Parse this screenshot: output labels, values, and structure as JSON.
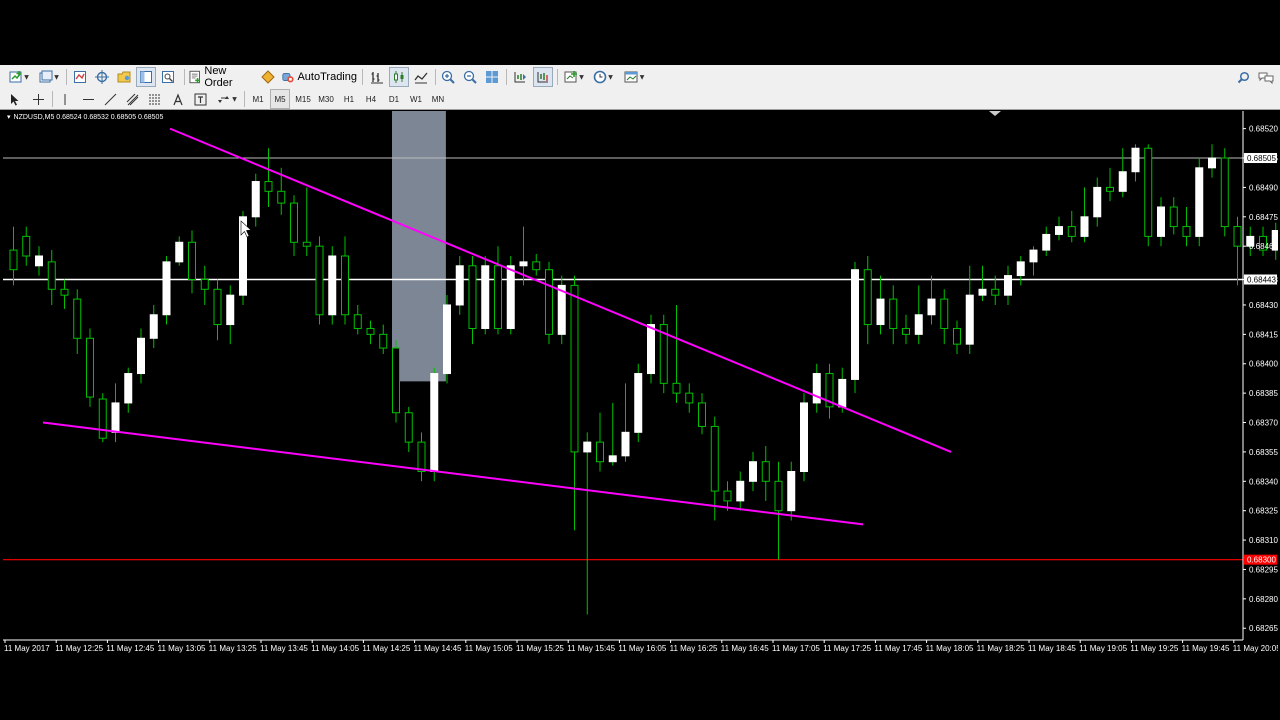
{
  "toolbar": {
    "new_order_label": "New Order",
    "autotrading_label": "AutoTrading",
    "timeframes": [
      "M1",
      "M5",
      "M15",
      "M30",
      "H1",
      "H4",
      "D1",
      "W1",
      "MN"
    ],
    "active_timeframe": "M5"
  },
  "chart": {
    "symbol_info": "NZDUSD,M5  0.68524 0.68532 0.68505 0.68505",
    "colors": {
      "background": "#000000",
      "bull_body": "#ffffff",
      "bear_body": "#000000",
      "wick": "#00c000",
      "trendline": "#ff00ff",
      "level_line": "#ffffff",
      "red_level": "#ff0000",
      "highlight_box": "#c8d8f0",
      "axis_text": "#ffffff"
    }
  },
  "chart_data": {
    "type": "candlestick",
    "price_ticks": [
      "0.68520",
      "0.68505",
      "0.68490",
      "0.68475",
      "0.68460",
      "0.68443",
      "0.68430",
      "0.68415",
      "0.68400",
      "0.68385",
      "0.68370",
      "0.68355",
      "0.68340",
      "0.68325",
      "0.68310",
      "0.68300",
      "0.68295",
      "0.68280",
      "0.68265"
    ],
    "price_label_current": "0.68505",
    "price_label_level": "0.68443",
    "price_label_red": "0.68300",
    "time_labels": [
      "11 May 2017",
      "11 May 12:25",
      "11 May 12:45",
      "11 May 13:05",
      "11 May 13:25",
      "11 May 13:45",
      "11 May 14:05",
      "11 May 14:25",
      "11 May 14:45",
      "11 May 15:05",
      "11 May 15:25",
      "11 May 15:45",
      "11 May 16:05",
      "11 May 16:25",
      "11 May 16:45",
      "11 May 17:05",
      "11 May 17:25",
      "11 May 17:45",
      "11 May 18:05",
      "11 May 18:25",
      "11 May 18:45",
      "11 May 19:05",
      "11 May 19:25",
      "11 May 19:45",
      "11 May 20:05"
    ],
    "horizontal_levels": {
      "white_upper": 0.68505,
      "white_level": 0.68443,
      "red": 0.683
    },
    "trendlines": [
      {
        "from": [
          0,
          0.6852
        ],
        "to": [
          37,
          0.68355
        ]
      },
      {
        "from": [
          -3,
          0.6837
        ],
        "to": [
          34,
          0.68318
        ]
      }
    ],
    "highlight_zone": {
      "from_index": 30,
      "to_index": 33.6,
      "low": 0.68391
    },
    "candles": [
      [
        0.68458,
        0.68448,
        0.6847,
        0.6844
      ],
      [
        0.68465,
        0.68455,
        0.6847,
        0.6845
      ],
      [
        0.6845,
        0.68455,
        0.6846,
        0.68445
      ],
      [
        0.68452,
        0.68438,
        0.68458,
        0.6843
      ],
      [
        0.68438,
        0.68435,
        0.68443,
        0.68428
      ],
      [
        0.68433,
        0.68413,
        0.68438,
        0.68405
      ],
      [
        0.68413,
        0.68383,
        0.68418,
        0.68378
      ],
      [
        0.68382,
        0.68362,
        0.68385,
        0.6836
      ],
      [
        0.68365,
        0.6838,
        0.6839,
        0.6836
      ],
      [
        0.6838,
        0.68395,
        0.68398,
        0.68375
      ],
      [
        0.68395,
        0.68413,
        0.68418,
        0.6839
      ],
      [
        0.68413,
        0.68425,
        0.6843,
        0.68408
      ],
      [
        0.68425,
        0.68452,
        0.68455,
        0.6842
      ],
      [
        0.68452,
        0.68462,
        0.68465,
        0.6845
      ],
      [
        0.68462,
        0.68443,
        0.68468,
        0.68436
      ],
      [
        0.68443,
        0.68438,
        0.6845,
        0.6843
      ],
      [
        0.68438,
        0.6842,
        0.68443,
        0.68412
      ],
      [
        0.6842,
        0.68435,
        0.6844,
        0.6841
      ],
      [
        0.68435,
        0.68475,
        0.68478,
        0.6843
      ],
      [
        0.68475,
        0.68493,
        0.68497,
        0.6847
      ],
      [
        0.68493,
        0.68488,
        0.6851,
        0.6848
      ],
      [
        0.68488,
        0.68482,
        0.685,
        0.68476
      ],
      [
        0.68482,
        0.68462,
        0.68486,
        0.68455
      ],
      [
        0.68462,
        0.6846,
        0.6849,
        0.68455
      ],
      [
        0.6846,
        0.68425,
        0.68465,
        0.6842
      ],
      [
        0.68425,
        0.68455,
        0.6846,
        0.6842
      ],
      [
        0.68455,
        0.68425,
        0.68465,
        0.6842
      ],
      [
        0.68425,
        0.68418,
        0.6843,
        0.68415
      ],
      [
        0.68418,
        0.68415,
        0.68422,
        0.6841
      ],
      [
        0.68415,
        0.68408,
        0.6842,
        0.68405
      ],
      [
        0.68408,
        0.68375,
        0.68412,
        0.6837
      ],
      [
        0.68375,
        0.6836,
        0.68378,
        0.68355
      ],
      [
        0.6836,
        0.68345,
        0.68365,
        0.6834
      ],
      [
        0.68345,
        0.68395,
        0.68398,
        0.6834
      ],
      [
        0.68395,
        0.6843,
        0.68435,
        0.6839
      ],
      [
        0.6843,
        0.6845,
        0.68455,
        0.68425
      ],
      [
        0.6845,
        0.68418,
        0.68455,
        0.6841
      ],
      [
        0.68418,
        0.6845,
        0.68455,
        0.68415
      ],
      [
        0.6845,
        0.68418,
        0.6846,
        0.68415
      ],
      [
        0.68418,
        0.6845,
        0.68455,
        0.68415
      ],
      [
        0.6845,
        0.68452,
        0.6847,
        0.6844
      ],
      [
        0.68452,
        0.68448,
        0.68456,
        0.68445
      ],
      [
        0.68448,
        0.68415,
        0.68452,
        0.6841
      ],
      [
        0.68415,
        0.6844,
        0.68445,
        0.6841
      ],
      [
        0.6844,
        0.68355,
        0.68445,
        0.68315
      ],
      [
        0.68355,
        0.6836,
        0.68365,
        0.68272
      ],
      [
        0.6836,
        0.6835,
        0.68375,
        0.68345
      ],
      [
        0.6835,
        0.68353,
        0.6838,
        0.68348
      ],
      [
        0.68353,
        0.68365,
        0.6839,
        0.6835
      ],
      [
        0.68365,
        0.68395,
        0.684,
        0.6836
      ],
      [
        0.68395,
        0.6842,
        0.68425,
        0.6839
      ],
      [
        0.6842,
        0.6839,
        0.68425,
        0.68385
      ],
      [
        0.6839,
        0.68385,
        0.6843,
        0.6838
      ],
      [
        0.68385,
        0.6838,
        0.6839,
        0.68375
      ],
      [
        0.6838,
        0.68368,
        0.68385,
        0.68364
      ],
      [
        0.68368,
        0.68335,
        0.68373,
        0.6832
      ],
      [
        0.68335,
        0.6833,
        0.6834,
        0.68325
      ],
      [
        0.6833,
        0.6834,
        0.68345,
        0.68325
      ],
      [
        0.6834,
        0.6835,
        0.68355,
        0.68335
      ],
      [
        0.6835,
        0.6834,
        0.68358,
        0.6833
      ],
      [
        0.6834,
        0.68325,
        0.6835,
        0.683
      ],
      [
        0.68325,
        0.68345,
        0.6835,
        0.6832
      ],
      [
        0.68345,
        0.6838,
        0.68385,
        0.6834
      ],
      [
        0.6838,
        0.68395,
        0.684,
        0.68375
      ],
      [
        0.68395,
        0.68378,
        0.684,
        0.68372
      ],
      [
        0.68378,
        0.68392,
        0.68398,
        0.68375
      ],
      [
        0.68392,
        0.68448,
        0.68452,
        0.68385
      ],
      [
        0.68448,
        0.6842,
        0.68455,
        0.6841
      ],
      [
        0.6842,
        0.68433,
        0.68445,
        0.68415
      ],
      [
        0.68433,
        0.68418,
        0.6844,
        0.6841
      ],
      [
        0.68418,
        0.68415,
        0.68425,
        0.6841
      ],
      [
        0.68415,
        0.68425,
        0.6844,
        0.6841
      ],
      [
        0.68425,
        0.68433,
        0.68445,
        0.6842
      ],
      [
        0.68433,
        0.68418,
        0.68438,
        0.6841
      ],
      [
        0.68418,
        0.6841,
        0.68422,
        0.68405
      ],
      [
        0.6841,
        0.68435,
        0.6845,
        0.68405
      ],
      [
        0.68435,
        0.68438,
        0.6845,
        0.68432
      ],
      [
        0.68438,
        0.68435,
        0.68445,
        0.6843
      ],
      [
        0.68435,
        0.68445,
        0.6845,
        0.6843
      ],
      [
        0.68445,
        0.68452,
        0.68455,
        0.6844
      ],
      [
        0.68452,
        0.68458,
        0.6846,
        0.68445
      ],
      [
        0.68458,
        0.68466,
        0.6847,
        0.68455
      ],
      [
        0.68466,
        0.6847,
        0.68475,
        0.68463
      ],
      [
        0.6847,
        0.68465,
        0.68478,
        0.68462
      ],
      [
        0.68465,
        0.68475,
        0.6849,
        0.68462
      ],
      [
        0.68475,
        0.6849,
        0.68495,
        0.6847
      ],
      [
        0.6849,
        0.68488,
        0.685,
        0.68483
      ],
      [
        0.68488,
        0.68498,
        0.6851,
        0.68485
      ],
      [
        0.68498,
        0.6851,
        0.68512,
        0.68493
      ],
      [
        0.6851,
        0.68465,
        0.68512,
        0.6846
      ],
      [
        0.68465,
        0.6848,
        0.68485,
        0.6846
      ],
      [
        0.6848,
        0.6847,
        0.68485,
        0.68466
      ],
      [
        0.6847,
        0.68465,
        0.6848,
        0.6846
      ],
      [
        0.68465,
        0.685,
        0.68505,
        0.6846
      ],
      [
        0.685,
        0.68505,
        0.68512,
        0.68495
      ],
      [
        0.68505,
        0.6847,
        0.6851,
        0.68465
      ],
      [
        0.6847,
        0.6846,
        0.68475,
        0.6844
      ],
      [
        0.6846,
        0.68465,
        0.6847,
        0.68455
      ],
      [
        0.68465,
        0.68458,
        0.6847,
        0.68455
      ],
      [
        0.68458,
        0.68468,
        0.68472,
        0.68453
      ],
      [
        0.68468,
        0.68452,
        0.6847,
        0.68448
      ],
      [
        0.68452,
        0.6845,
        0.6846,
        0.68445
      ],
      [
        0.6845,
        0.6844,
        0.68455,
        0.6843
      ],
      [
        0.6844,
        0.6845,
        0.68455,
        0.68435
      ],
      [
        0.6845,
        0.68435,
        0.68455,
        0.68425
      ],
      [
        0.68435,
        0.68472,
        0.68475,
        0.68433
      ],
      [
        0.68472,
        0.68468,
        0.68478,
        0.6846
      ],
      [
        0.68468,
        0.6852,
        0.68524,
        0.68462
      ]
    ]
  }
}
